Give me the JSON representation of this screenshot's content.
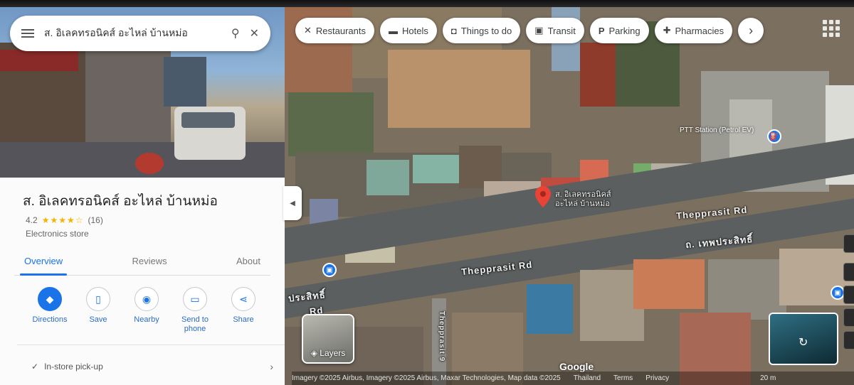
{
  "search": {
    "query": "ส. อิเลคทรอนิคส์ อะไหล่ บ้านหม่อ"
  },
  "place": {
    "name": "ส. อิเลคทรอนิคส์ อะไหล่ บ้านหม่อ",
    "rating": "4.2",
    "stars": "★★★★☆",
    "review_count": "(16)",
    "category": "Electronics store"
  },
  "tabs": [
    "Overview",
    "Reviews",
    "About"
  ],
  "actions": [
    {
      "label": "Directions",
      "icon": "directions-icon",
      "glyph": "◆"
    },
    {
      "label": "Save",
      "icon": "bookmark-icon",
      "glyph": "▯"
    },
    {
      "label": "Nearby",
      "icon": "nearby-icon",
      "glyph": "◉"
    },
    {
      "label": "Send to phone",
      "icon": "phone-icon",
      "glyph": "▭"
    },
    {
      "label": "Share",
      "icon": "share-icon",
      "glyph": "⋖"
    }
  ],
  "pickup": {
    "label": "In-store pick-up"
  },
  "chips": [
    {
      "label": "Restaurants",
      "icon": "fork-knife-icon",
      "glyph": "🍴"
    },
    {
      "label": "Hotels",
      "icon": "bed-icon",
      "glyph": "▬"
    },
    {
      "label": "Things to do",
      "icon": "camera-icon",
      "glyph": "◘"
    },
    {
      "label": "Transit",
      "icon": "bus-icon",
      "glyph": "▣"
    },
    {
      "label": "Parking",
      "icon": "parking-icon",
      "glyph": "P"
    },
    {
      "label": "Pharmacies",
      "icon": "pharmacy-icon",
      "glyph": "✚"
    }
  ],
  "map": {
    "roads": {
      "main_1": "Thepprasit Rd",
      "main_2": "Thepprasit Rd",
      "thai_road": "ถ. เทพประสิทธิ์",
      "left_fragment": "ประสิทธิ์",
      "left_fragment_2": "Rd",
      "side_street": "Thepprasit 9"
    },
    "pin_label": "ส. อิเลคทรอนิคส์\nอะไหล่ บ้านหม่อ",
    "poi_label": "PTT Station (Petrol EV)",
    "layers_label": "Layers",
    "google_logo": "Google",
    "attribution": {
      "imagery": "Imagery ©2025 Airbus, Imagery ©2025 Airbus, Maxar Technologies, Map data ©2025",
      "region": "Thailand",
      "terms": "Terms",
      "privacy": "Privacy",
      "scale": "20 m"
    }
  },
  "colors": {
    "accent": "#1a73e8",
    "star": "#f2b400",
    "pin": "#ea4335"
  }
}
